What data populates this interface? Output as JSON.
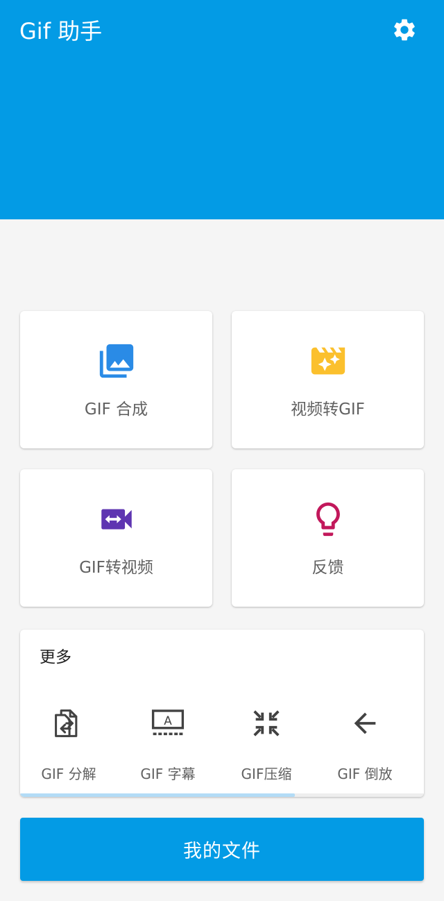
{
  "header": {
    "title": "Gif 助手",
    "settings_icon": "gear-icon",
    "background": "#039be5"
  },
  "tiles": [
    {
      "label": "GIF 合成",
      "icon": "photo-library-icon",
      "color": "#2a8be6"
    },
    {
      "label": "视频转GIF",
      "icon": "movie-filter-icon",
      "color": "#fbc02d"
    },
    {
      "label": "GIF转视频",
      "icon": "video-camera-arrows-icon",
      "color": "#5e35b1"
    },
    {
      "label": "反馈",
      "icon": "lightbulb-icon",
      "color": "#c2185b"
    }
  ],
  "more": {
    "title": "更多",
    "tools": [
      {
        "label": "GIF 分解",
        "icon": "split-pages-icon"
      },
      {
        "label": "GIF 字幕",
        "icon": "subtitle-icon"
      },
      {
        "label": "GIF压缩",
        "icon": "compress-arrows-icon"
      },
      {
        "label": "GIF 倒放",
        "icon": "arrow-left-icon"
      }
    ],
    "scroll_progress": 0.68
  },
  "footer": {
    "my_files_label": "我的文件"
  }
}
